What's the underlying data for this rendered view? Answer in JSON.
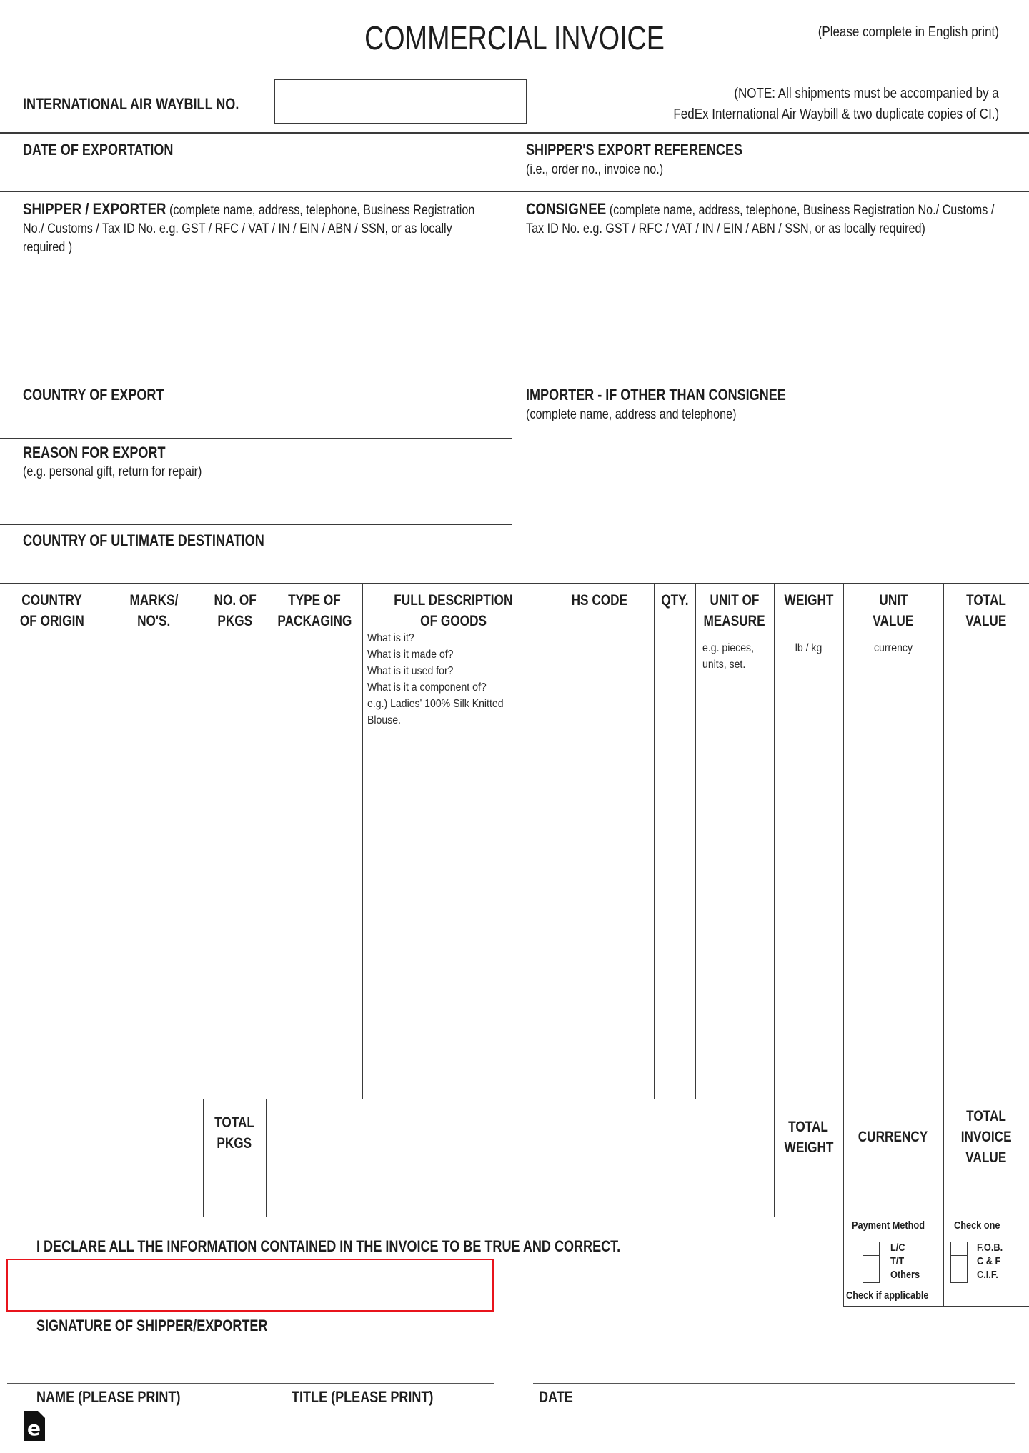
{
  "header": {
    "title": "COMMERCIAL INVOICE",
    "instruction": "(Please complete in English print)",
    "waybill_label": "INTERNATIONAL AIR WAYBILL NO.",
    "waybill_value": "",
    "note_line1": "(NOTE: All shipments must be accompanied by a",
    "note_line2": "FedEx International Air Waybill & two duplicate copies of CI.)"
  },
  "fields": {
    "date_of_exportation": {
      "label": "DATE OF EXPORTATION",
      "value": ""
    },
    "shipper_export_refs": {
      "label": "SHIPPER'S EXPORT REFERENCES",
      "hint": "(i.e., order no., invoice no.)",
      "value": ""
    },
    "shipper": {
      "label": "SHIPPER / EXPORTER",
      "hint": "(complete name, address, telephone, Business Registration No./ Customs / Tax ID No. e.g. GST / RFC / VAT / IN / EIN / ABN / SSN, or as locally required )",
      "value": ""
    },
    "consignee": {
      "label": "CONSIGNEE",
      "hint": "(complete name, address, telephone, Business Registration No./ Customs / Tax ID No. e.g. GST / RFC / VAT / IN / EIN / ABN / SSN, or as locally required)",
      "value": ""
    },
    "country_of_export": {
      "label": "COUNTRY OF EXPORT",
      "value": ""
    },
    "importer": {
      "label": "IMPORTER - IF OTHER THAN CONSIGNEE",
      "hint": "(complete name, address and telephone)",
      "value": ""
    },
    "reason_for_export": {
      "label": "REASON FOR EXPORT",
      "hint": "(e.g. personal gift, return for repair)",
      "value": ""
    },
    "country_of_destination": {
      "label": "COUNTRY OF ULTIMATE DESTINATION",
      "value": ""
    }
  },
  "table": {
    "columns": [
      {
        "line1": "COUNTRY",
        "line2": "OF ORIGIN",
        "hint": []
      },
      {
        "line1": "MARKS/",
        "line2": "NO'S.",
        "hint": []
      },
      {
        "line1": "NO. OF",
        "line2": "PKGS",
        "hint": []
      },
      {
        "line1": "TYPE OF",
        "line2": "PACKAGING",
        "hint": []
      },
      {
        "line1": "FULL DESCRIPTION",
        "line2": "OF GOODS",
        "hint": [
          "What is it?",
          "What is it made of?",
          "What is it used for?",
          "What is it a component of?",
          "e.g.) Ladies' 100% Silk Knitted",
          "Blouse."
        ]
      },
      {
        "line1": "HS CODE",
        "line2": "",
        "hint": []
      },
      {
        "line1": "QTY.",
        "line2": "",
        "hint": []
      },
      {
        "line1": "UNIT OF",
        "line2": "MEASURE",
        "hint": [
          "e.g. pieces,",
          "units, set."
        ]
      },
      {
        "line1": "WEIGHT",
        "line2": "",
        "hint": [
          "lb / kg"
        ]
      },
      {
        "line1": "UNIT",
        "line2": "VALUE",
        "hint": [
          "currency"
        ]
      },
      {
        "line1": "TOTAL",
        "line2": "VALUE",
        "hint": []
      }
    ],
    "rows": []
  },
  "totals": {
    "total_pkgs": {
      "line1": "TOTAL",
      "line2": "PKGS",
      "value": ""
    },
    "total_weight": {
      "line1": "TOTAL",
      "line2": "WEIGHT",
      "value": ""
    },
    "currency": {
      "line1": "CURRENCY",
      "value": ""
    },
    "total_invoice_value": {
      "line1": "TOTAL",
      "line2": "INVOICE",
      "line3": "VALUE",
      "value": ""
    }
  },
  "payment": {
    "method_title": "Payment Method",
    "method_options": [
      "L/C",
      "T/T",
      "Others"
    ],
    "method_footer": "Check if applicable",
    "terms_title": "Check one",
    "terms_options": [
      "F.O.B.",
      "C & F",
      "C.I.F."
    ]
  },
  "declaration": {
    "text": "I DECLARE ALL THE INFORMATION CONTAINED IN THE INVOICE TO BE TRUE AND CORRECT.",
    "signature_label": "SIGNATURE OF SHIPPER/EXPORTER",
    "name_label": "NAME (PLEASE PRINT)",
    "title_label": "TITLE (PLEASE PRINT)",
    "date_label": "DATE"
  },
  "logo": {
    "glyph": "e"
  },
  "colors": {
    "highlight": "#e8141c",
    "rule": "#3a3a3a"
  }
}
